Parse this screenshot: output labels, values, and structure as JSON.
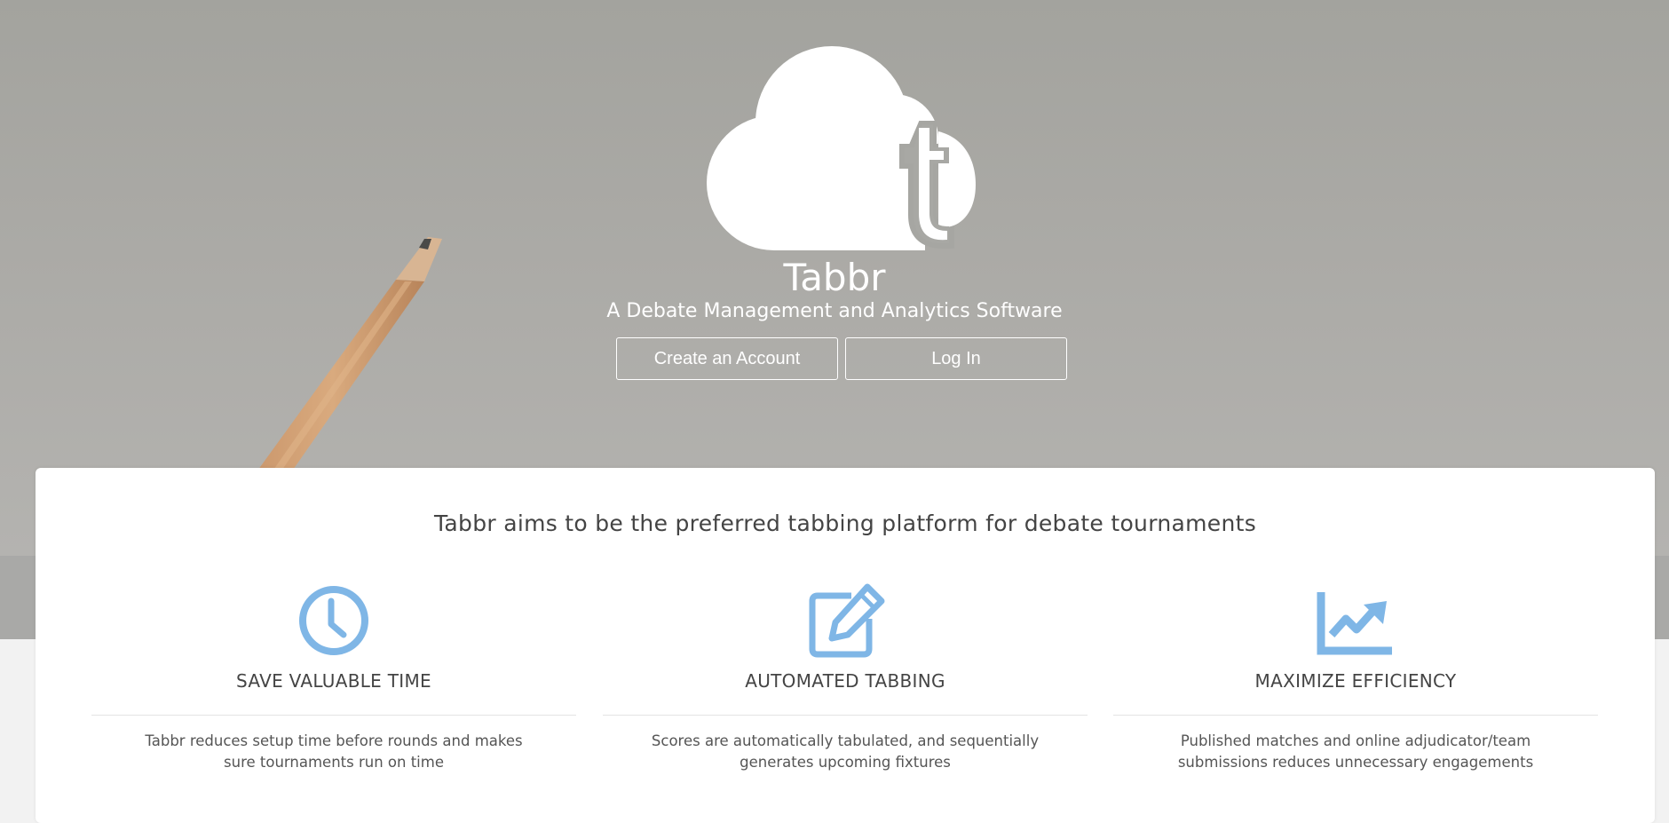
{
  "hero": {
    "title": "Tabbr",
    "subtitle": "A Debate Management and Analytics Software",
    "create_account_label": "Create an Account",
    "login_label": "Log In",
    "logo_icon": "cloud-t-logo-icon"
  },
  "intro": {
    "tagline": "Tabbr aims to be the preferred tabbing platform for debate tournaments"
  },
  "features": [
    {
      "icon": "clock-icon",
      "title": "SAVE VALUABLE TIME",
      "description": "Tabbr reduces setup time before rounds and makes sure tournaments run on time"
    },
    {
      "icon": "edit-icon",
      "title": "AUTOMATED TABBING",
      "description": "Scores are automatically tabulated, and sequentially generates upcoming fixtures"
    },
    {
      "icon": "chart-line-icon",
      "title": "MAXIMIZE EFFICIENCY",
      "description": "Published matches and online adjudicator/team submissions reduces unnecessary engagements"
    }
  ],
  "colors": {
    "accent": "#7fb6e6",
    "hero_bg": "#a8a8a4",
    "text_dark": "#444444"
  }
}
